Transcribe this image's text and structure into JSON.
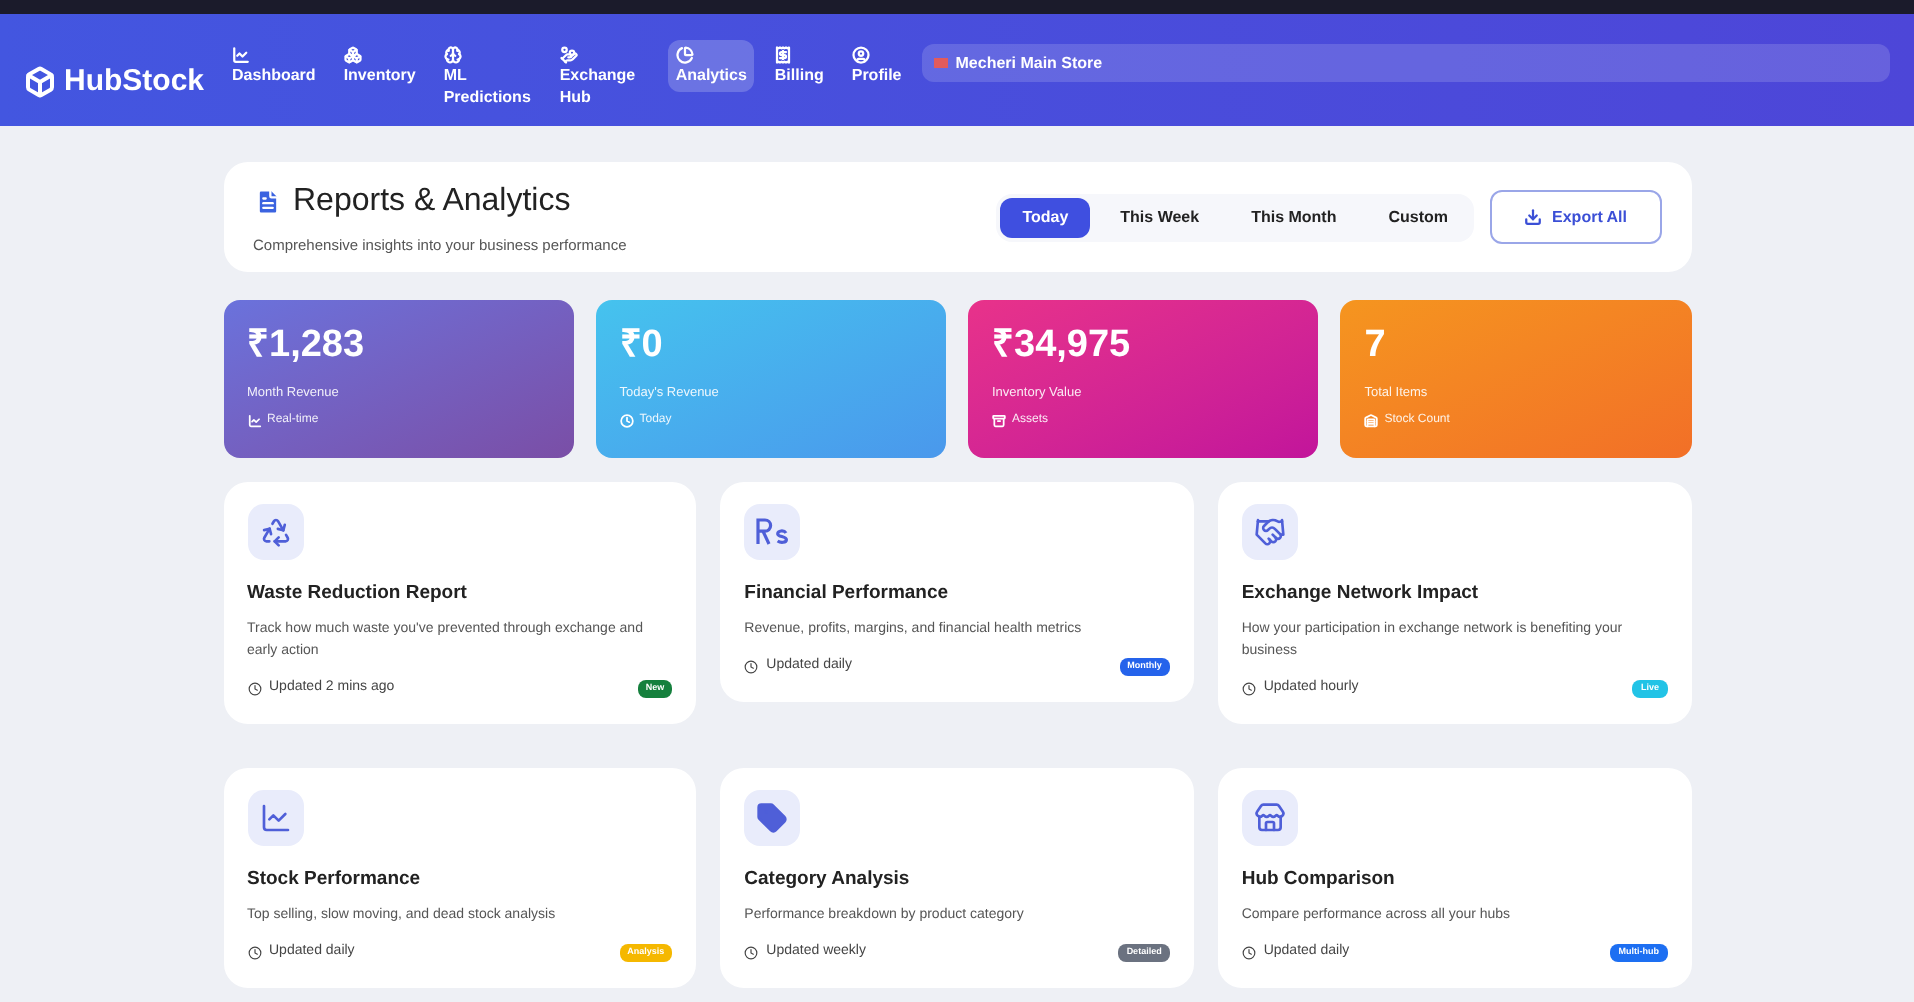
{
  "brand": "HubStock",
  "nav": [
    {
      "label": "Dashboard",
      "kind": "chart",
      "selected": false
    },
    {
      "label": "Inventory",
      "kind": "boxes",
      "selected": false
    },
    {
      "label": "ML Predictions",
      "kind": "brain",
      "selected": false
    },
    {
      "label": "Exchange Hub",
      "kind": "hand",
      "selected": false
    },
    {
      "label": "Analytics",
      "kind": "pie",
      "selected": true
    },
    {
      "label": "Billing",
      "kind": "bill",
      "selected": false
    },
    {
      "label": "Profile",
      "kind": "user",
      "selected": false
    }
  ],
  "store": "Mecheri Main Store",
  "header": {
    "title": "Reports & Analytics",
    "subtitle": "Comprehensive insights into your business performance"
  },
  "periods": [
    {
      "label": "Today",
      "selected": true
    },
    {
      "label": "This Week",
      "selected": false
    },
    {
      "label": "This Month",
      "selected": false
    },
    {
      "label": "Custom",
      "selected": false
    }
  ],
  "export": "Export All",
  "stats": [
    {
      "value": "₹1,283",
      "label": "Month Revenue",
      "note": "Real-time",
      "kind": "month"
    },
    {
      "value": "₹0",
      "label": "Today's Revenue",
      "note": "Today",
      "kind": "today"
    },
    {
      "value": "₹34,975",
      "label": "Inventory Value",
      "note": "Assets",
      "kind": "inventory"
    },
    {
      "value": "7",
      "label": "Total Items",
      "note": "Stock Count",
      "kind": "items"
    }
  ],
  "reports": [
    {
      "kind": "recycle",
      "title": "Waste Reduction Report",
      "description": "Track how much waste you've prevented through exchange and early action",
      "updated": "Updated 2 mins ago",
      "badge": "New",
      "color": "#15803d"
    },
    {
      "kind": "rupee",
      "title": "Financial Performance",
      "description": "Revenue, profits, margins, and financial health metrics",
      "updated": "Updated daily",
      "badge": "Monthly",
      "color": "#2563eb"
    },
    {
      "kind": "handshake",
      "title": "Exchange Network Impact",
      "description": "How your participation in exchange network is benefiting your business",
      "updated": "Updated hourly",
      "badge": "Live",
      "color": "#22c3e6"
    },
    {
      "kind": "line",
      "title": "Stock Performance",
      "description": "Top selling, slow moving, and dead stock analysis",
      "updated": "Updated daily",
      "badge": "Analysis",
      "color": "#f5b800"
    },
    {
      "kind": "tag",
      "title": "Category Analysis",
      "description": "Performance breakdown by product category",
      "updated": "Updated weekly",
      "badge": "Detailed",
      "color": "#6b7280"
    },
    {
      "kind": "store",
      "title": "Hub Comparison",
      "description": "Compare performance across all your hubs",
      "updated": "Updated daily",
      "badge": "Multi-hub",
      "color": "#1d6ff2"
    }
  ]
}
